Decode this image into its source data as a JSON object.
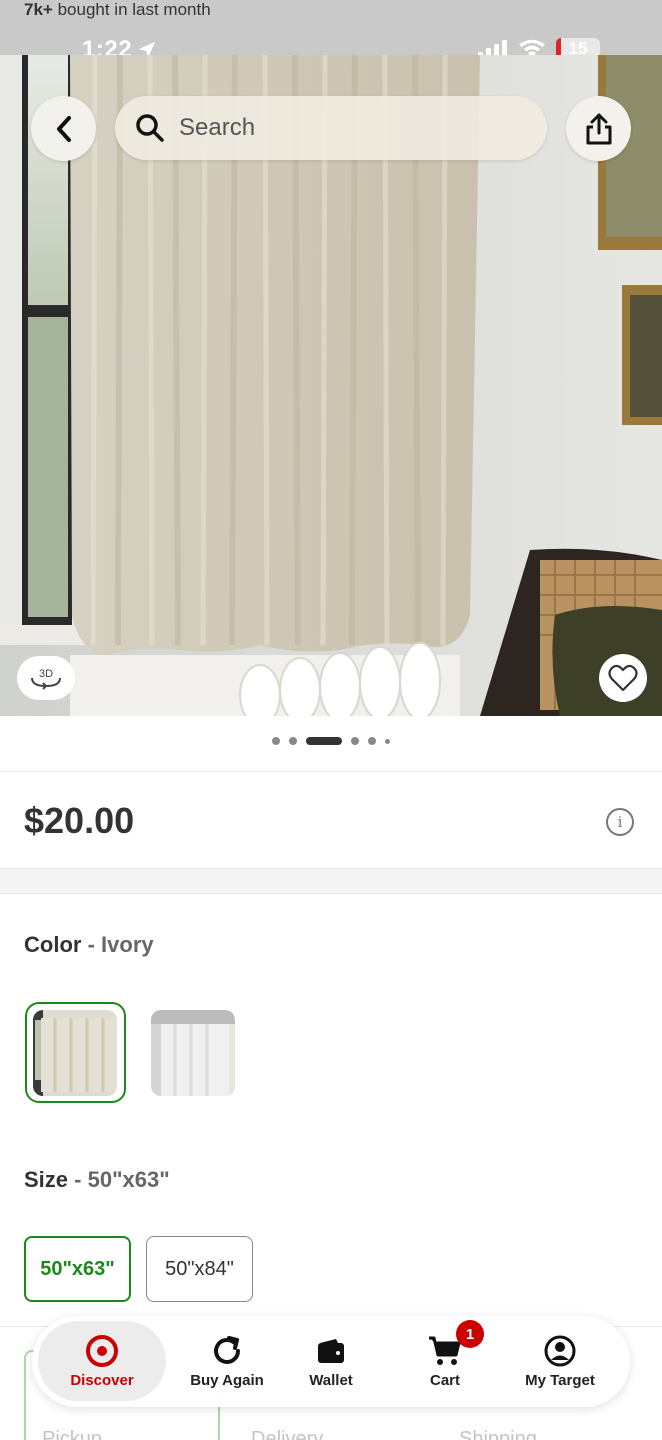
{
  "status_bar": {
    "bought_bold": "7k+",
    "bought_rest": "bought in last month",
    "time": "1:22",
    "battery": "15"
  },
  "header": {
    "search_placeholder": "Search"
  },
  "hero": {
    "badge_3d": "3D",
    "carousel_dots": 6,
    "carousel_active_index": 2
  },
  "product": {
    "price": "$20.00"
  },
  "options": {
    "color_label": "Color",
    "color_separator": "-",
    "color_value": "Ivory",
    "size_label": "Size",
    "size_separator": "-",
    "size_value": "50\"x63\"",
    "sizes": [
      "50\"x63\"",
      "50\"x84\""
    ],
    "selected_size_index": 0
  },
  "fulfillment": {
    "options": [
      "Pickup",
      "Delivery",
      "Shipping"
    ]
  },
  "bottom_nav": {
    "items": [
      {
        "label": "Discover",
        "icon": "target-logo-icon"
      },
      {
        "label": "Buy Again",
        "icon": "refresh-icon"
      },
      {
        "label": "Wallet",
        "icon": "wallet-icon"
      },
      {
        "label": "Cart",
        "icon": "cart-icon"
      },
      {
        "label": "My Target",
        "icon": "account-icon"
      }
    ],
    "cart_badge": "1",
    "active_index": 0
  },
  "colors": {
    "brand_red": "#cc0000",
    "selected_green": "#1a8a1a"
  }
}
